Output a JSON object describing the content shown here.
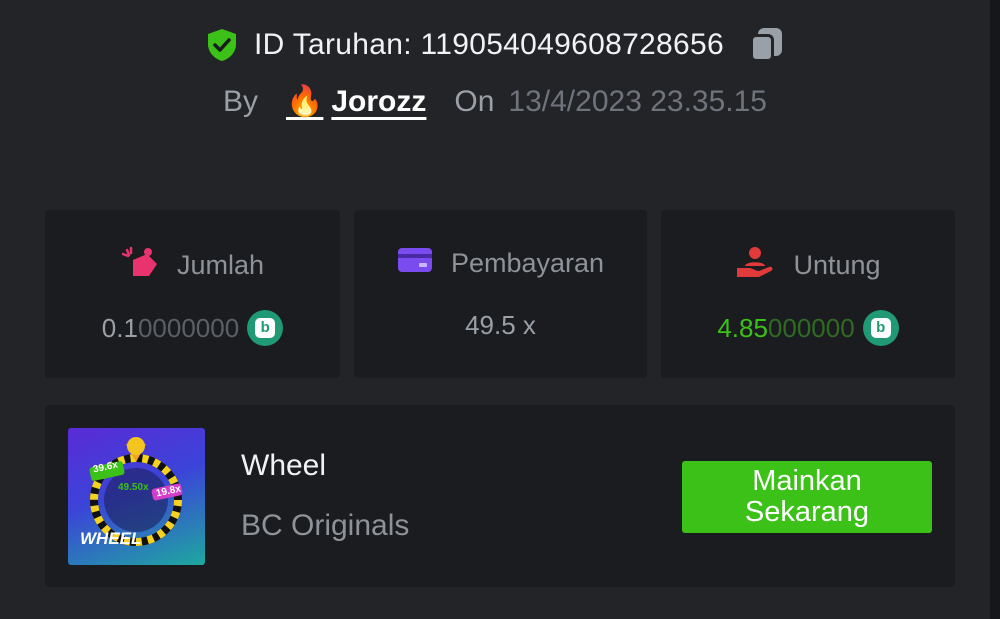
{
  "header": {
    "bet_id": "ID Taruhan: 119054049608728656",
    "by_label": "By",
    "username": "Jorozz",
    "on_label": "On",
    "date": "13/4/2023 23.35.15"
  },
  "stats": [
    {
      "label": "Jumlah",
      "value_main": "0.1",
      "value_dim": "0000000",
      "icon": "bet-amount-icon",
      "coin": true
    },
    {
      "label": "Pembayaran",
      "value_main": "49.5 x",
      "value_dim": "",
      "icon": "card-icon",
      "coin": false
    },
    {
      "label": "Untung",
      "value_main": "4.85",
      "value_dim": "000000",
      "icon": "profit-hand-icon",
      "coin": true
    }
  ],
  "game": {
    "title": "Wheel",
    "provider": "BC Originals",
    "thumb_label": "WHEEL",
    "thumb_multipliers": [
      "39.6x",
      "49.50x",
      "19.8x"
    ],
    "play_label": "Mainkan Sekarang"
  },
  "colors": {
    "background": "#232428",
    "card": "#1b1c1f",
    "accent_green": "#3bc117",
    "coin": "#1f9a74"
  }
}
